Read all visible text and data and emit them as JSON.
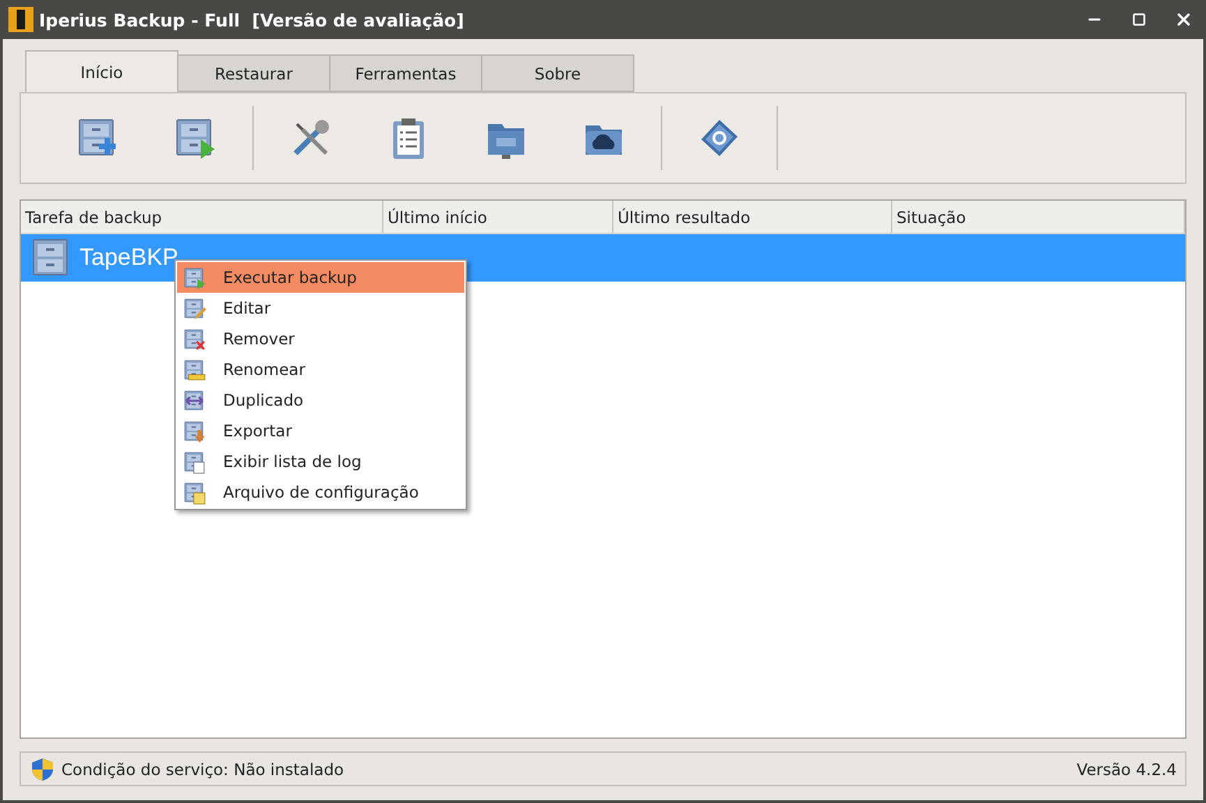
{
  "window": {
    "title": "Iperius Backup - Full  [Versão de avaliação]"
  },
  "tabs": [
    {
      "label": "Início",
      "selected": true
    },
    {
      "label": "Restaurar",
      "selected": false
    },
    {
      "label": "Ferramentas",
      "selected": false
    },
    {
      "label": "Sobre",
      "selected": false
    }
  ],
  "toolbar": [
    {
      "kind": "add"
    },
    {
      "kind": "run"
    },
    {
      "kind": "separator"
    },
    {
      "kind": "tools"
    },
    {
      "kind": "clipboard"
    },
    {
      "kind": "ftp"
    },
    {
      "kind": "cloud"
    },
    {
      "kind": "separator"
    },
    {
      "kind": "help"
    },
    {
      "kind": "separator"
    }
  ],
  "table": {
    "columns": [
      "Tarefa de backup",
      "Último início",
      "Último resultado",
      "Situação"
    ],
    "rows": [
      {
        "name": "TapeBKP",
        "selected": true
      }
    ]
  },
  "context_menu": [
    {
      "label": "Executar backup",
      "kind": "run",
      "selected": true
    },
    {
      "label": "Editar",
      "kind": "edit",
      "selected": false
    },
    {
      "label": "Remover",
      "kind": "remove",
      "selected": false
    },
    {
      "label": "Renomear",
      "kind": "rename",
      "selected": false
    },
    {
      "label": "Duplicado",
      "kind": "duplicate",
      "selected": false
    },
    {
      "label": "Exportar",
      "kind": "export",
      "selected": false
    },
    {
      "label": "Exibir lista de log",
      "kind": "log",
      "selected": false
    },
    {
      "label": "Arquivo de configuração",
      "kind": "config",
      "selected": false
    }
  ],
  "status_bar": {
    "service": "Condição do serviço: Não instalado",
    "version": "Versão 4.2.4"
  }
}
